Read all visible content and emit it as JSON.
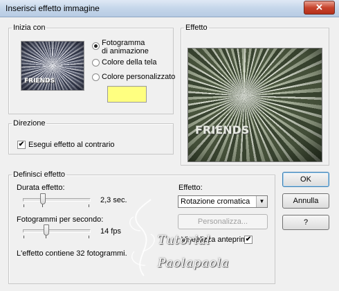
{
  "window": {
    "title": "Inserisci effetto immagine",
    "close_glyph": "✕"
  },
  "start_group": {
    "legend": "Inizia con",
    "thumbnail_text": "FRIENDS",
    "options": [
      {
        "label_line1": "Fotogramma",
        "label_line2": "di animazione",
        "checked": true
      },
      {
        "label": "Colore della tela",
        "checked": false
      },
      {
        "label": "Colore personalizzato",
        "checked": false
      }
    ],
    "custom_color": "#ffff80"
  },
  "effect_preview": {
    "legend": "Effetto",
    "preview_text": "FRIENDS"
  },
  "direction_group": {
    "legend": "Direzione",
    "reverse_label": "Esegui effetto al contrario",
    "reverse_checked": true,
    "check_glyph": "✔"
  },
  "define_group": {
    "legend": "Definisci effetto",
    "duration_label": "Durata effetto:",
    "duration_value": "2,3 sec.",
    "fps_label": "Fotogrammi per secondo:",
    "fps_value": "14 fps",
    "effect_label": "Effetto:",
    "effect_selected": "Rotazione cromatica",
    "customize_label": "Personalizza...",
    "preview_label": "Visualizza anteprima",
    "preview_checked": true,
    "check_glyph": "✔",
    "frame_count_text": "L'effetto contiene 32 fotogrammi."
  },
  "buttons": {
    "ok": "OK",
    "cancel": "Annulla",
    "help": "?"
  },
  "watermark": {
    "line1": "Tutorial",
    "line2": "Paolapaola"
  }
}
